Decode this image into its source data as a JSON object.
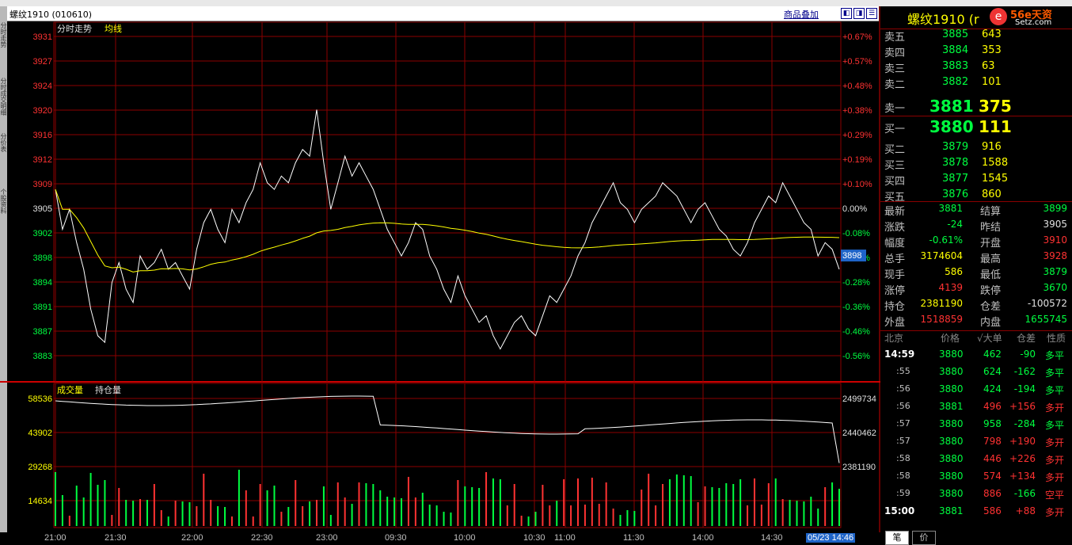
{
  "window": {
    "title": "螺纹1910 (010610)",
    "overlay_button": "商品叠加",
    "logo_text": "螺纹1910 (r",
    "logo_site_text": "Setz.com",
    "logo_brand": "56e天资"
  },
  "left_strip": [
    "分时走势",
    "分时成交明细",
    "分价表",
    "个股资料"
  ],
  "main_chart": {
    "legend_left": "分时走势",
    "legend_avg": "均线",
    "price_ticks": [
      "3931",
      "3927",
      "3924",
      "3920",
      "3916",
      "3912",
      "3909",
      "3905",
      "3902",
      "3898",
      "3894",
      "3891",
      "3887",
      "3883"
    ],
    "pct_ticks": [
      "+0.67%",
      "+0.57%",
      "+0.48%",
      "+0.38%",
      "+0.29%",
      "+0.19%",
      "+0.10%",
      "0.00%",
      "-0.08%",
      "-0.18%",
      "-0.28%",
      "-0.36%",
      "-0.46%",
      "-0.56%"
    ],
    "cursor_price": "3898"
  },
  "volume_chart": {
    "legend_vol": "成交量",
    "legend_oi": "持仓量",
    "vol_ticks": [
      "58536",
      "43902",
      "29268",
      "14634"
    ],
    "oi_ticks": [
      "2499734",
      "2440462",
      "2381190"
    ]
  },
  "time_axis": {
    "ticks": [
      "21:00",
      "21:30",
      "22:00",
      "22:30",
      "23:00",
      "09:30",
      "10:00",
      "10:30",
      "11:00",
      "11:30",
      "14:00",
      "14:30"
    ],
    "cursor_time": "05/23 14:46"
  },
  "chart_data": {
    "type": "line",
    "title": "",
    "series": [
      {
        "name": "分时走势",
        "values": [
          3908,
          3902,
          3905,
          3900,
          3896,
          3890,
          3886,
          3885,
          3894,
          3897,
          3893,
          3891,
          3898,
          3896,
          3897,
          3899,
          3896,
          3897,
          3895,
          3893,
          3899,
          3903,
          3905,
          3902,
          3900,
          3905,
          3903,
          3906,
          3908,
          3912,
          3909,
          3908,
          3910,
          3909,
          3912,
          3914,
          3913,
          3920,
          3912,
          3905,
          3909,
          3913,
          3910,
          3912,
          3910,
          3908,
          3905,
          3902,
          3900,
          3898,
          3900,
          3903,
          3902,
          3898,
          3896,
          3893,
          3891,
          3895,
          3892,
          3890,
          3888,
          3889,
          3886,
          3884,
          3886,
          3888,
          3889,
          3887,
          3886,
          3889,
          3892,
          3891,
          3893,
          3895,
          3898,
          3900,
          3903,
          3905,
          3907,
          3909,
          3906,
          3905,
          3903,
          3905,
          3906,
          3907,
          3909,
          3908,
          3907,
          3905,
          3903,
          3905,
          3906,
          3904,
          3902,
          3901,
          3899,
          3898,
          3900,
          3903,
          3905,
          3907,
          3906,
          3909,
          3907,
          3905,
          3903,
          3902,
          3898,
          3900,
          3899,
          3896
        ]
      },
      {
        "name": "均线",
        "values": []
      }
    ],
    "ylim": [
      3883,
      3931
    ]
  },
  "order_book": {
    "asks": [
      {
        "label": "卖五",
        "price": "3885",
        "vol": "643"
      },
      {
        "label": "卖四",
        "price": "3884",
        "vol": "353"
      },
      {
        "label": "卖三",
        "price": "3883",
        "vol": "63"
      },
      {
        "label": "卖二",
        "price": "3882",
        "vol": "101"
      },
      {
        "label": "卖一",
        "price": "3881",
        "vol": "375"
      }
    ],
    "bids": [
      {
        "label": "买一",
        "price": "3880",
        "vol": "111"
      },
      {
        "label": "买二",
        "price": "3879",
        "vol": "916"
      },
      {
        "label": "买三",
        "price": "3878",
        "vol": "1588"
      },
      {
        "label": "买四",
        "price": "3877",
        "vol": "1545"
      },
      {
        "label": "买五",
        "price": "3876",
        "vol": "860"
      }
    ]
  },
  "stats": [
    {
      "l1": "最新",
      "v1": "3881",
      "c1": "g",
      "l2": "结算",
      "v2": "3899",
      "c2": "g"
    },
    {
      "l1": "涨跌",
      "v1": "-24",
      "c1": "g",
      "l2": "昨结",
      "v2": "3905",
      "c2": "w"
    },
    {
      "l1": "幅度",
      "v1": "-0.61%",
      "c1": "g",
      "l2": "开盘",
      "v2": "3910",
      "c2": "r"
    },
    {
      "l1": "总手",
      "v1": "3174604",
      "c1": "y",
      "l2": "最高",
      "v2": "3928",
      "c2": "r"
    },
    {
      "l1": "现手",
      "v1": "586",
      "c1": "y",
      "l2": "最低",
      "v2": "3879",
      "c2": "g"
    },
    {
      "l1": "涨停",
      "v1": "4139",
      "c1": "r",
      "l2": "跌停",
      "v2": "3670",
      "c2": "g"
    },
    {
      "l1": "持仓",
      "v1": "2381190",
      "c1": "y",
      "l2": "仓差",
      "v2": "-100572",
      "c2": "w"
    },
    {
      "l1": "外盘",
      "v1": "1518859",
      "c1": "r",
      "l2": "内盘",
      "v2": "1655745",
      "c2": "g"
    }
  ],
  "ticks_header": {
    "time": "北京",
    "price": "价格",
    "vol": "√大单",
    "oi": "仓差",
    "nature": "性质"
  },
  "ticks": [
    {
      "time": "14:59",
      "price": "3880",
      "vol": "462",
      "oi": "-90",
      "nature": "多平",
      "vc": "g",
      "nc": "g"
    },
    {
      "time": ":55",
      "price": "3880",
      "vol": "624",
      "oi": "-162",
      "nature": "多平",
      "vc": "g",
      "nc": "g"
    },
    {
      "time": ":56",
      "price": "3880",
      "vol": "424",
      "oi": "-194",
      "nature": "多平",
      "vc": "g",
      "nc": "g"
    },
    {
      "time": ":56",
      "price": "3881",
      "vol": "496",
      "oi": "+156",
      "nature": "多开",
      "vc": "r",
      "nc": "r"
    },
    {
      "time": ":57",
      "price": "3880",
      "vol": "958",
      "oi": "-284",
      "nature": "多平",
      "vc": "g",
      "nc": "g"
    },
    {
      "time": ":57",
      "price": "3880",
      "vol": "798",
      "oi": "+190",
      "nature": "多开",
      "vc": "r",
      "nc": "r"
    },
    {
      "time": ":58",
      "price": "3880",
      "vol": "446",
      "oi": "+226",
      "nature": "多开",
      "vc": "r",
      "nc": "r"
    },
    {
      "time": ":58",
      "price": "3880",
      "vol": "574",
      "oi": "+134",
      "nature": "多开",
      "vc": "r",
      "nc": "r"
    },
    {
      "time": ":59",
      "price": "3880",
      "vol": "886",
      "oi": "-166",
      "nature": "空平",
      "vc": "r",
      "nc": "r"
    },
    {
      "time": "15:00",
      "price": "3881",
      "vol": "586",
      "oi": "+88",
      "nature": "多开",
      "vc": "r",
      "nc": "r"
    }
  ],
  "bottom_tabs": [
    "笔",
    "价"
  ],
  "colors": {
    "grid": "#8b0000",
    "price_line": "#ffffff",
    "avg_line": "#ffff00",
    "up": "#ff3232",
    "down": "#00ff40"
  }
}
